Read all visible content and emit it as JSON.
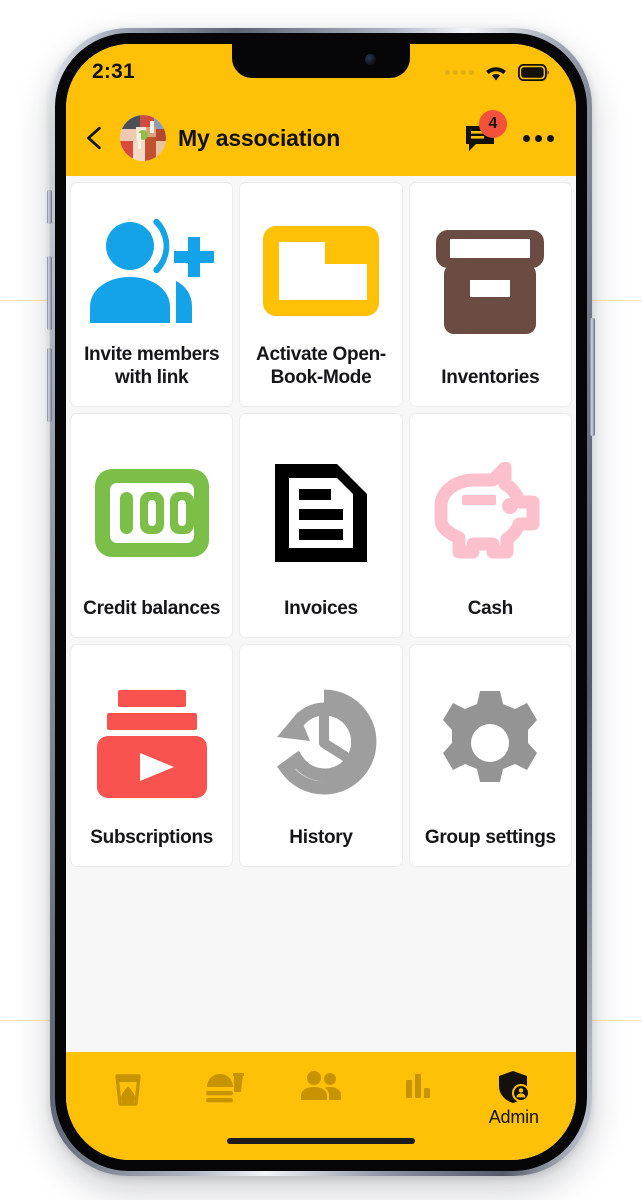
{
  "status_bar": {
    "time": "2:31",
    "signal_icon": "signal-dots-icon",
    "wifi_icon": "wifi-icon",
    "battery_icon": "battery-full-icon"
  },
  "app_bar": {
    "back_icon": "back-chevron-icon",
    "avatar_icon": "group-photo-avatar",
    "title": "My association",
    "messages_icon": "message-icon",
    "messages_badge": "4",
    "overflow_icon": "more-options-icon"
  },
  "grid": {
    "tiles": [
      {
        "label": "Invite members with link",
        "icon": "person-add-icon",
        "color": "#14A2E8"
      },
      {
        "label": "Activate Open-Book-Mode",
        "icon": "folder-icon",
        "color": "#FFC107"
      },
      {
        "label": "Inventories",
        "icon": "archive-box-icon",
        "color": "#6B4C42"
      },
      {
        "label": "Credit balances",
        "icon": "banknote-100-icon",
        "color": "#7CBF48"
      },
      {
        "label": "Invoices",
        "icon": "document-lines-icon",
        "color": "#000000"
      },
      {
        "label": "Cash",
        "icon": "piggy-bank-icon",
        "color": "#FBC0CB"
      },
      {
        "label": "Subscriptions",
        "icon": "subscriptions-play-icon",
        "color": "#F9534F"
      },
      {
        "label": "History",
        "icon": "history-clock-icon",
        "color": "#9E9E9E"
      },
      {
        "label": "Group settings",
        "icon": "gear-icon",
        "color": "#949494"
      }
    ]
  },
  "bottom_nav": {
    "items": [
      {
        "label": "",
        "icon": "drink-glass-icon"
      },
      {
        "label": "",
        "icon": "food-burger-drink-icon"
      },
      {
        "label": "",
        "icon": "people-icon"
      },
      {
        "label": "",
        "icon": "bar-chart-icon"
      },
      {
        "label": "Admin",
        "icon": "shield-admin-icon"
      }
    ]
  },
  "theme": {
    "accent": "#FFC107",
    "badge": "#F4513D",
    "screen_bg": "#F7F7F7",
    "tile_bg": "#FFFFFF",
    "text": "#15161A"
  }
}
